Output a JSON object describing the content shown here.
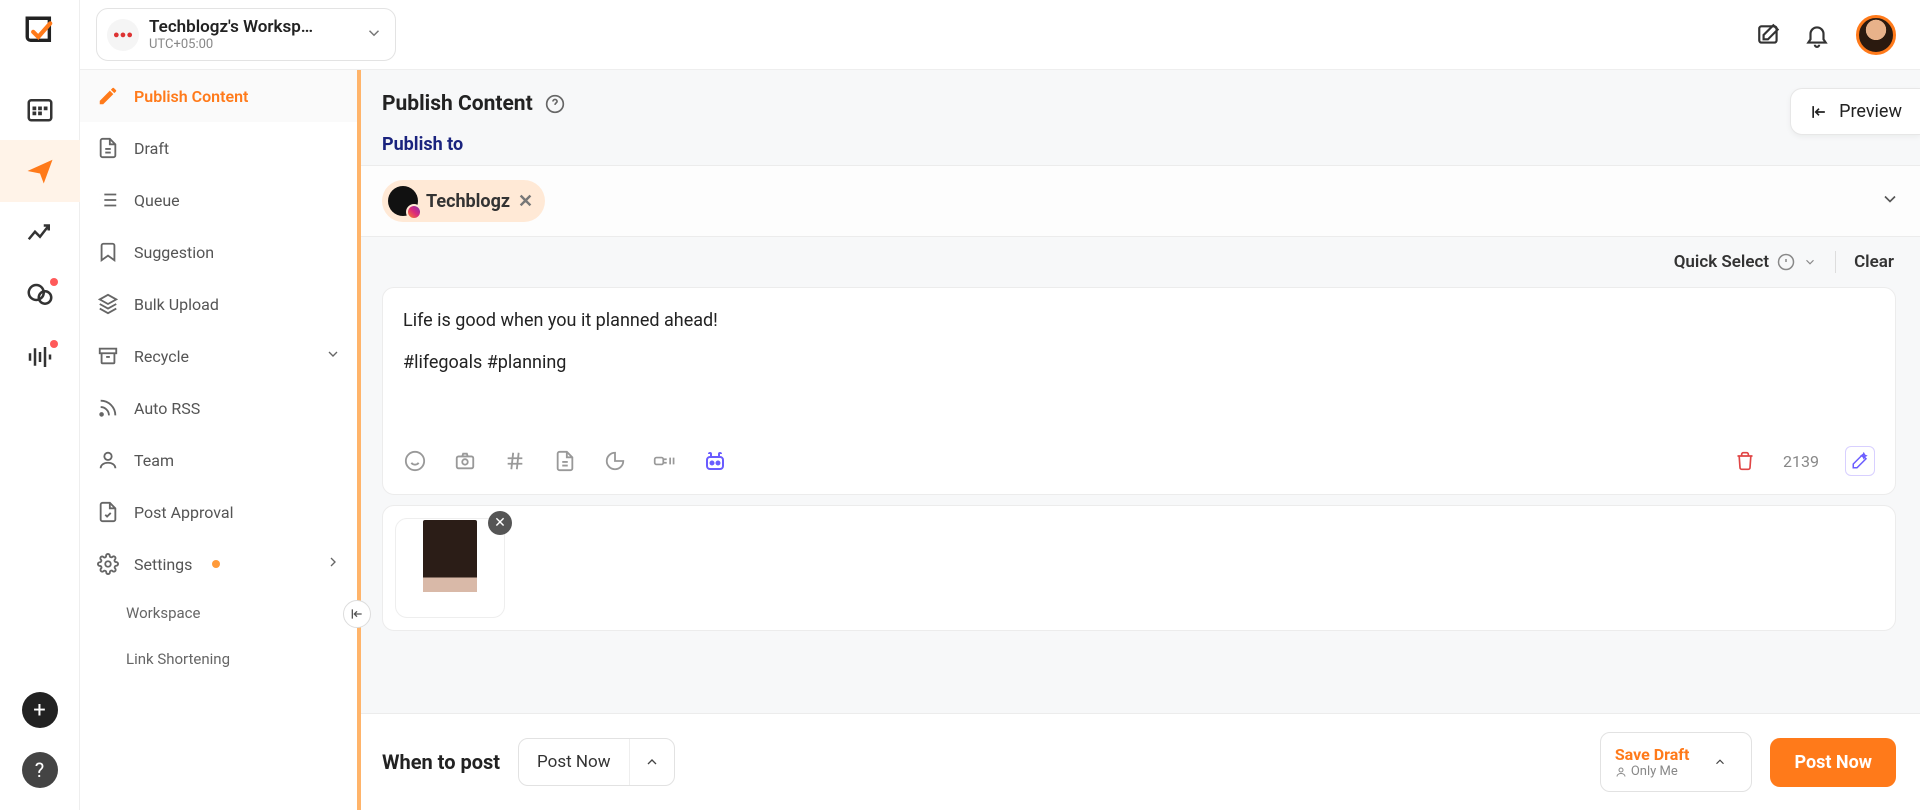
{
  "workspace": {
    "name": "Techblogz's Worksp…",
    "timezone": "UTC+05:00"
  },
  "nav": {
    "items": [
      {
        "label": "Publish Content"
      },
      {
        "label": "Draft"
      },
      {
        "label": "Queue"
      },
      {
        "label": "Suggestion"
      },
      {
        "label": "Bulk Upload"
      },
      {
        "label": "Recycle"
      },
      {
        "label": "Auto RSS"
      },
      {
        "label": "Team"
      },
      {
        "label": "Post Approval"
      },
      {
        "label": "Settings"
      }
    ],
    "settings_children": [
      {
        "label": "Workspace"
      },
      {
        "label": "Link Shortening"
      }
    ]
  },
  "page": {
    "title": "Publish Content",
    "section_label": "Publish to",
    "preview_label": "Preview"
  },
  "publish_to": {
    "account_name": "Techblogz"
  },
  "quickselect": {
    "label": "Quick Select",
    "clear": "Clear"
  },
  "composer": {
    "text": "Life is good when you it planned ahead!\n\n#lifegoals #planning",
    "char_remaining": "2139"
  },
  "schedule": {
    "when_label": "When to post",
    "mode": "Post Now",
    "save_draft": "Save Draft",
    "visibility": "Only Me",
    "post_now_button": "Post Now"
  }
}
